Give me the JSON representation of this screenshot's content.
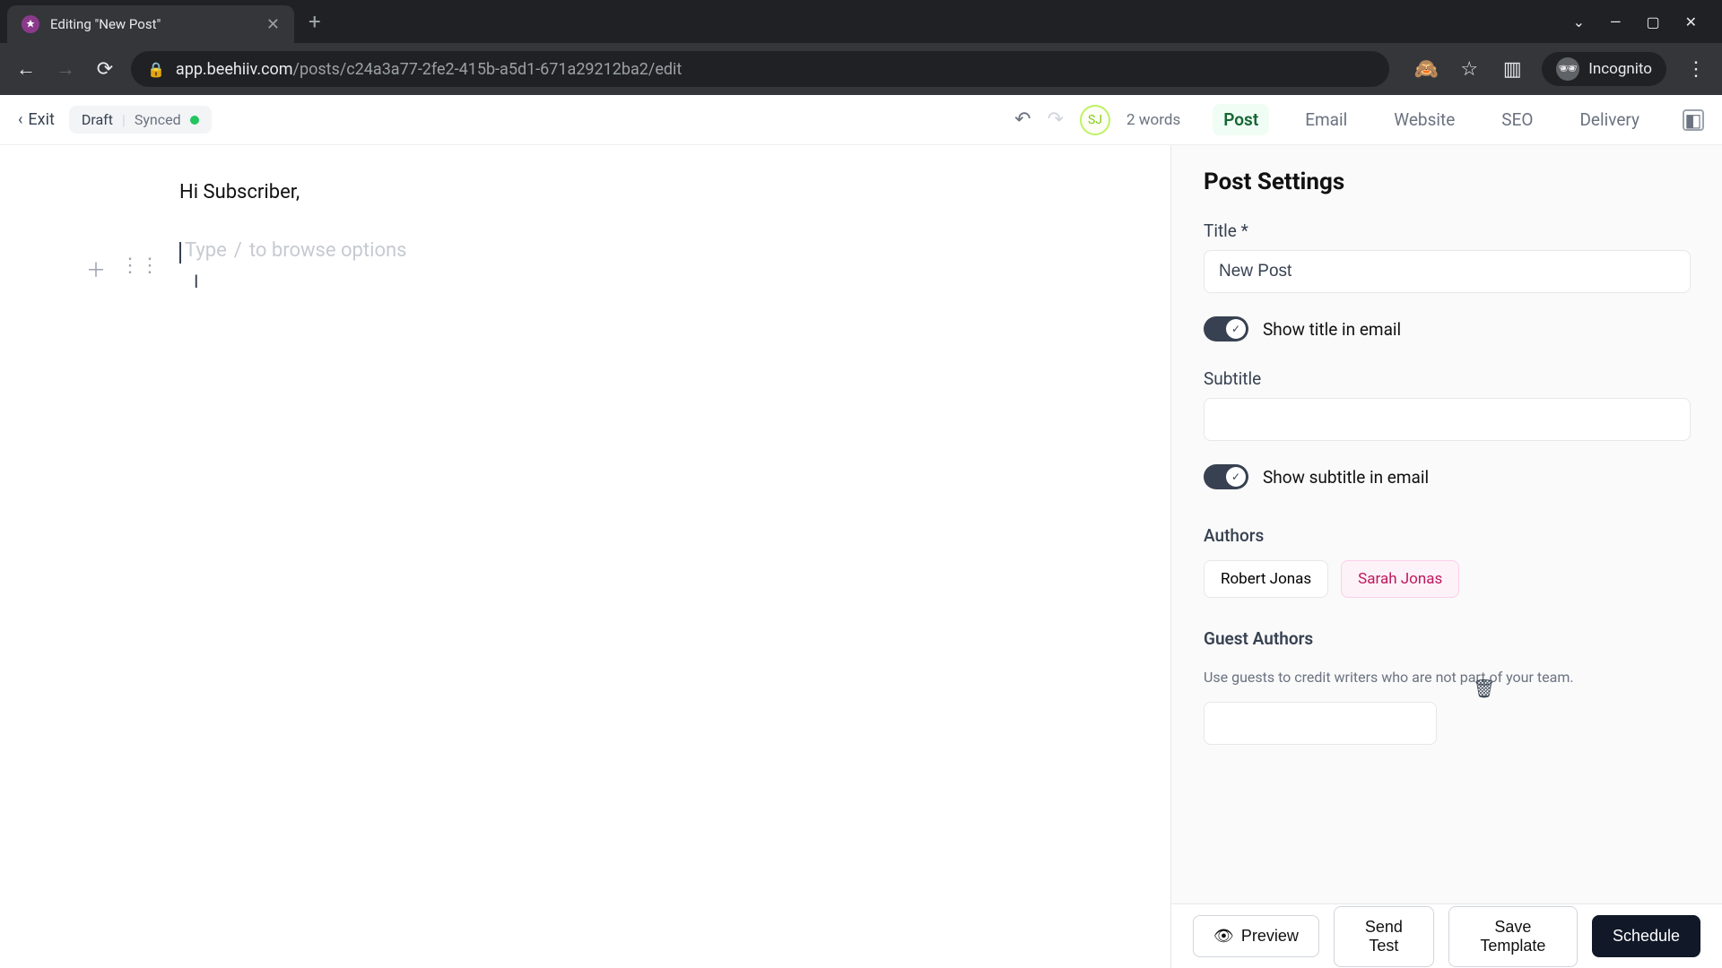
{
  "browser": {
    "tab_title": "Editing \"New Post\"",
    "url_host": "app.beehiiv.com",
    "url_path": "/posts/c24a3a77-2fe2-415b-a5d1-671a29212ba2/edit",
    "incognito_label": "Incognito"
  },
  "topbar": {
    "exit_label": "Exit",
    "status_draft": "Draft",
    "status_synced": "Synced",
    "avatar_initials": "SJ",
    "word_count": "2 words",
    "tabs": {
      "post": "Post",
      "email": "Email",
      "website": "Website",
      "seo": "SEO",
      "delivery": "Delivery"
    }
  },
  "editor": {
    "greeting": "Hi Subscriber,",
    "placeholder_prefix": "Type",
    "placeholder_slash": "/",
    "placeholder_suffix": "to browse options"
  },
  "settings": {
    "panel_title": "Post Settings",
    "title_label": "Title *",
    "title_value": "New Post",
    "show_title_label": "Show title in email",
    "subtitle_label": "Subtitle",
    "subtitle_value": "",
    "show_subtitle_label": "Show subtitle in email",
    "authors_label": "Authors",
    "authors": {
      "a0": "Robert Jonas",
      "a1": "Sarah Jonas"
    },
    "guest_label": "Guest Authors",
    "guest_desc": "Use guests to credit writers who are not part of your team."
  },
  "footer": {
    "preview": "Preview",
    "send_test": "Send Test",
    "save_template": "Save Template",
    "schedule": "Schedule"
  }
}
